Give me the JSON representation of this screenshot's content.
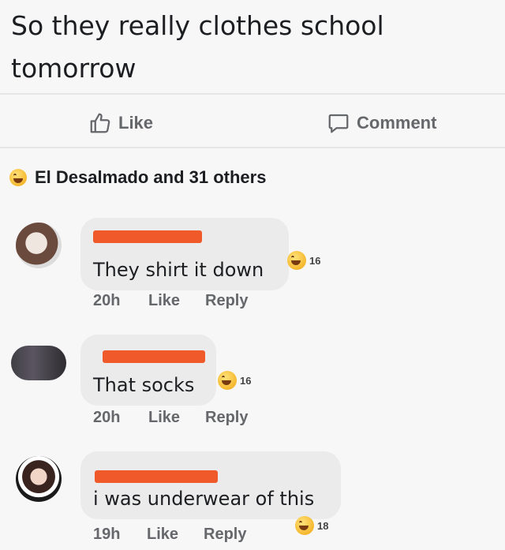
{
  "post": {
    "text": "So they really clothes school tomorrow"
  },
  "actions": {
    "like_label": "Like",
    "comment_label": "Comment"
  },
  "reactions": {
    "summary": "El Desalmado and 31 others"
  },
  "comments": [
    {
      "text": "They shirt it down",
      "reaction_count": "16",
      "time": "20h",
      "like_label": "Like",
      "reply_label": "Reply"
    },
    {
      "text": "That socks",
      "reaction_count": "16",
      "time": "20h",
      "like_label": "Like",
      "reply_label": "Reply"
    },
    {
      "text": "i was underwear of this",
      "reaction_count": "18",
      "time": "19h",
      "like_label": "Like",
      "reply_label": "Reply"
    }
  ],
  "colors": {
    "redaction": "#f05a2a",
    "bubble": "#ebebeb",
    "meta_text": "#65676b"
  },
  "icons": [
    "thumbs-up-icon",
    "comment-icon",
    "haha-emoji-icon"
  ]
}
